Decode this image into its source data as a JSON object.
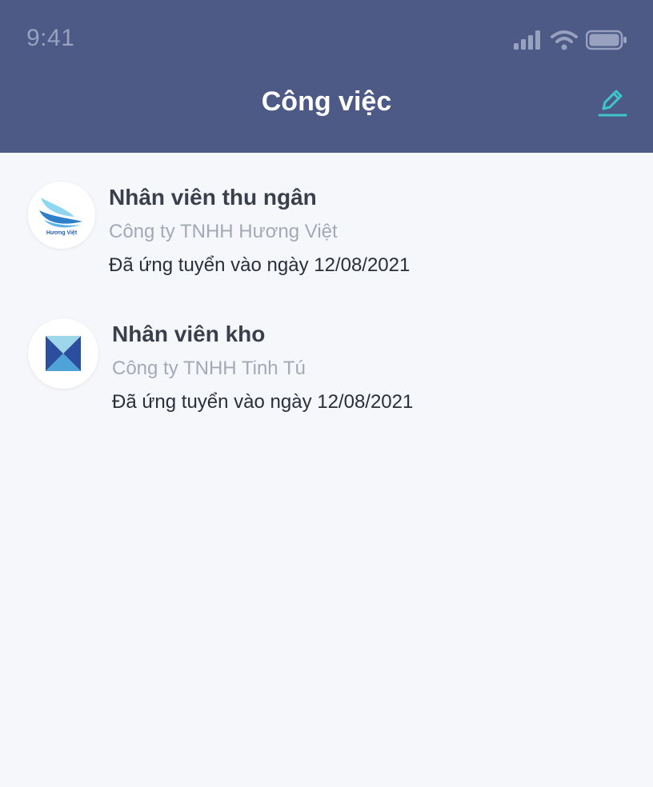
{
  "status_bar": {
    "time": "9:41"
  },
  "header": {
    "title": "Công việc",
    "edit_icon": "pencil-icon"
  },
  "colors": {
    "header_bg": "#4E5A86",
    "accent": "#3FC6C6",
    "page_bg": "#F5F7FB"
  },
  "jobs": [
    {
      "title": "Nhân viên thu ngân",
      "company": "Công ty TNHH Hương Việt",
      "applied": "Đã ứng tuyển vào ngày 12/08/2021",
      "logo_text": "Hương Việt"
    },
    {
      "title": "Nhân viên kho",
      "company": "Công ty TNHH Tinh Tú",
      "applied": "Đã ứng tuyển vào ngày 12/08/2021"
    }
  ]
}
